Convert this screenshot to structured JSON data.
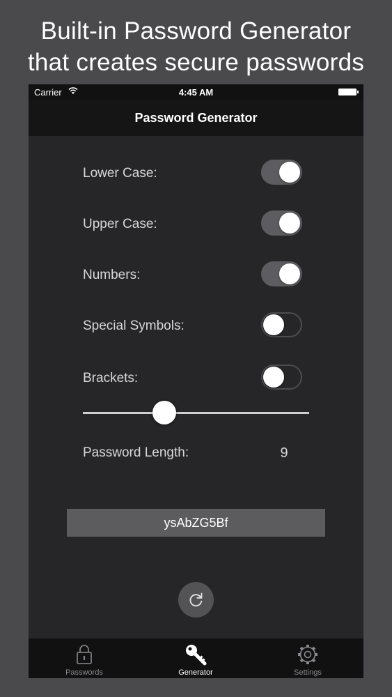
{
  "promo": {
    "line1": "Built-in Password Generator",
    "line2": "that creates secure passwords"
  },
  "status_bar": {
    "carrier": "Carrier",
    "time": "4:45 AM"
  },
  "nav": {
    "title": "Password Generator"
  },
  "options": [
    {
      "label": "Lower Case:",
      "on": true
    },
    {
      "label": "Upper Case:",
      "on": true
    },
    {
      "label": "Numbers:",
      "on": true
    },
    {
      "label": "Special Symbols:",
      "on": false
    },
    {
      "label": "Brackets:",
      "on": false
    }
  ],
  "length": {
    "label": "Password Length:",
    "value": "9",
    "slider_fraction": 0.36
  },
  "password": "ysAbZG5Bf",
  "tabs": [
    {
      "label": "Passwords",
      "icon": "lock-icon",
      "active": false
    },
    {
      "label": "Generator",
      "icon": "key-icon",
      "active": true
    },
    {
      "label": "Settings",
      "icon": "gear-icon",
      "active": false
    }
  ],
  "colors": {
    "background": "#4a494c",
    "screen": "#262628",
    "toggle_on": "#5d5d61"
  }
}
